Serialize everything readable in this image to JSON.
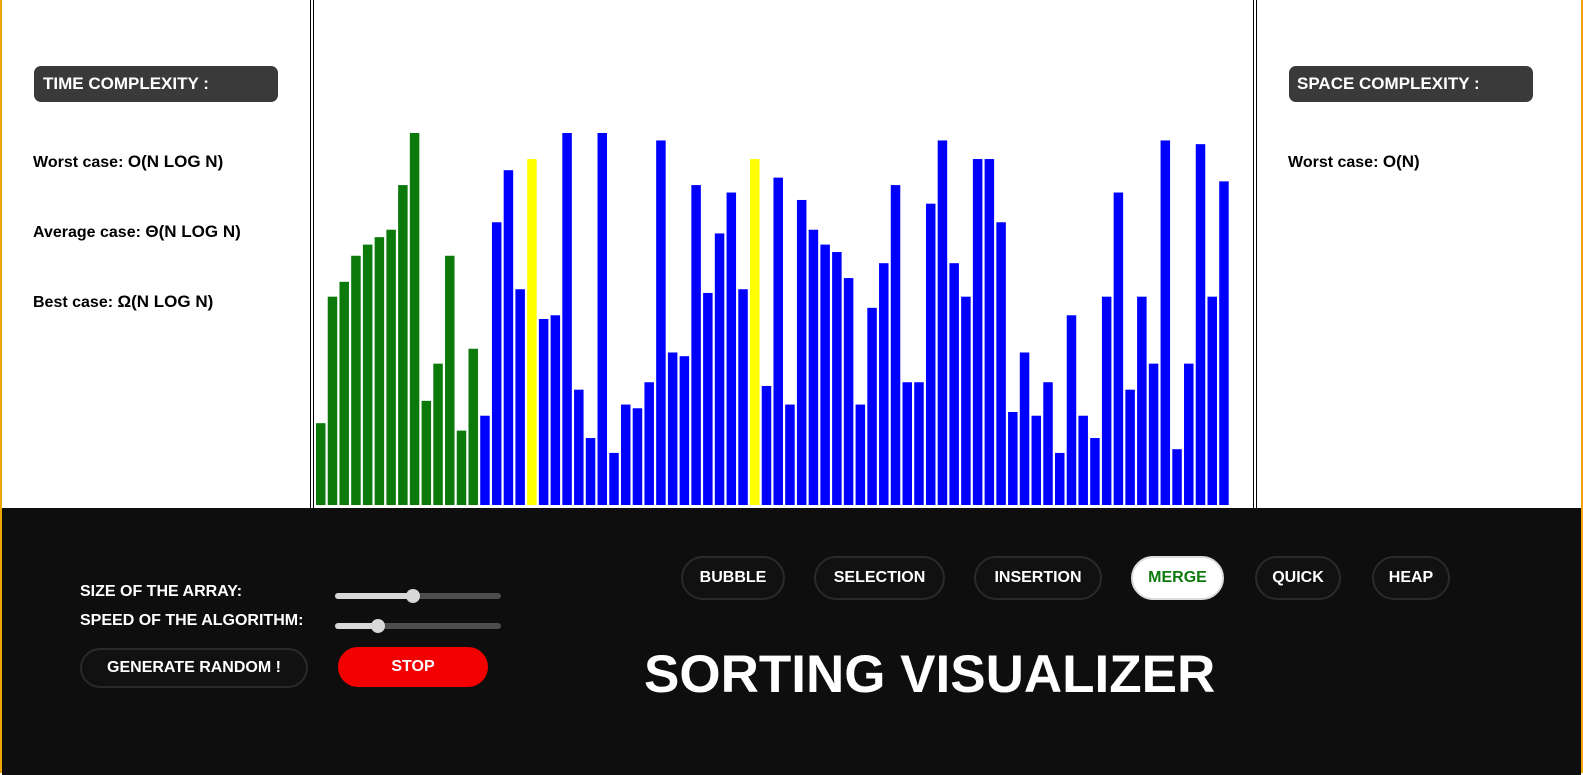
{
  "left_panel": {
    "heading": "TIME COMPLEXITY :",
    "worst_label": "Worst case: ",
    "worst_value": "O(N LOG N)",
    "average_label": "Average case: ",
    "average_value": "Θ(N LOG N)",
    "best_label": "Best case: ",
    "best_value": "Ω(N LOG N)"
  },
  "right_panel": {
    "heading": "SPACE COMPLEXITY :",
    "worst_label": "Worst case: ",
    "worst_value": "O(N)"
  },
  "controls": {
    "size_label": "SIZE OF THE ARRAY:",
    "size_level": 0.47,
    "speed_label": "SPEED OF THE ALGORITHM:",
    "speed_level": 0.26,
    "generate_label": "GENERATE RANDOM !",
    "stop_label": "STOP"
  },
  "algorithms": [
    {
      "label": "BUBBLE",
      "active": false
    },
    {
      "label": "SELECTION",
      "active": false
    },
    {
      "label": "INSERTION",
      "active": false
    },
    {
      "label": "MERGE",
      "active": true
    },
    {
      "label": "QUICK",
      "active": false
    },
    {
      "label": "HEAP",
      "active": false
    }
  ],
  "title": "SORTING VISUALIZER",
  "colors": {
    "sorted": "#0b7a0b",
    "unsorted": "#0000ff",
    "comparing": "#ffff00",
    "accent_border": "#f0a500",
    "stop": "#f30000"
  },
  "chart_data": {
    "type": "bar",
    "max_value": 100,
    "values": [
      22,
      56,
      60,
      67,
      70,
      72,
      74,
      86,
      100,
      28,
      38,
      67,
      20,
      42,
      24,
      76,
      90,
      58,
      93,
      50,
      51,
      100,
      31,
      18,
      100,
      14,
      27,
      26,
      33,
      98,
      41,
      40,
      86,
      57,
      73,
      84,
      58,
      93,
      32,
      88,
      27,
      82,
      74,
      70,
      68,
      61,
      27,
      53,
      65,
      86,
      33,
      33,
      81,
      98,
      65,
      56,
      93,
      93,
      76,
      25,
      41,
      24,
      33,
      14,
      51,
      24,
      18,
      56,
      84,
      31,
      56,
      38,
      98,
      15,
      38,
      97,
      56,
      87
    ],
    "states": [
      "s",
      "s",
      "s",
      "s",
      "s",
      "s",
      "s",
      "s",
      "s",
      "s",
      "s",
      "s",
      "s",
      "s",
      "u",
      "u",
      "u",
      "u",
      "c",
      "u",
      "u",
      "u",
      "u",
      "u",
      "u",
      "u",
      "u",
      "u",
      "u",
      "u",
      "u",
      "u",
      "u",
      "u",
      "u",
      "u",
      "u",
      "c",
      "u",
      "u",
      "u",
      "u",
      "u",
      "u",
      "u",
      "u",
      "u",
      "u",
      "u",
      "u",
      "u",
      "u",
      "u",
      "u",
      "u",
      "u",
      "u",
      "u",
      "u",
      "u",
      "u",
      "u",
      "u",
      "u",
      "u",
      "u",
      "u",
      "u",
      "u",
      "u",
      "u",
      "u",
      "u",
      "u",
      "u",
      "u",
      "u",
      "u"
    ]
  }
}
